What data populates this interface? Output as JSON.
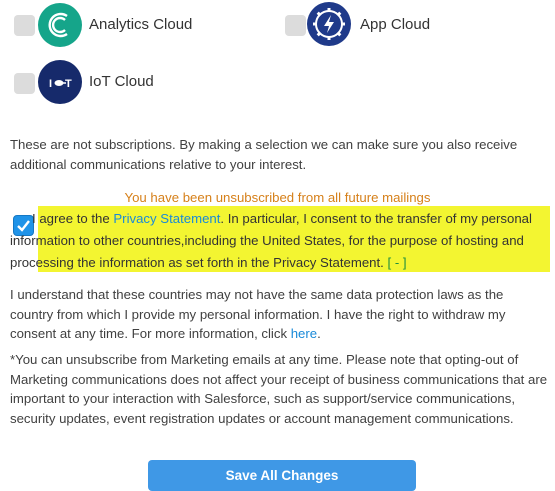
{
  "clouds": [
    {
      "label": "Analytics Cloud",
      "checked": false,
      "icon": "analytics-cloud-icon",
      "icon_color": "#15a58a"
    },
    {
      "label": "App Cloud",
      "checked": false,
      "icon": "app-cloud-gear-icon",
      "icon_color": "#1f3a8a"
    },
    {
      "label": "IoT Cloud",
      "checked": false,
      "icon": "iot-cloud-icon",
      "icon_color": "#162a6b"
    }
  ],
  "interest_note": "These are not subscriptions. By making a selection we can make sure you also receive additional communications relative to your interest.",
  "unsubscribed_message": "You have been unsubscribed from all future mailings",
  "consent": {
    "checked": true,
    "part1": "I agree to the ",
    "privacy_link": "Privacy Statement",
    "part2": ". In particular, I consent to the transfer of my personal information to other countries,including the United States, for the purpose of hosting and processing the information as set forth in the Privacy Statement. ",
    "collapse_toggle": "[ - ]"
  },
  "data_protection": {
    "text": "I understand that these countries may not have the same data protection laws as the country from which I provide my personal information. I have the right to withdraw my consent at any time. For more information, click ",
    "link": "here",
    "end": "."
  },
  "marketing_note": "*You can unsubscribe from Marketing emails at any time. Please note that opting-out of Marketing communications does not affect your receipt of business communications that are important to your interaction with Salesforce, such as support/service communications, security updates, event registration updates or account management communications.",
  "save_button": "Save All Changes",
  "colors": {
    "accent": "#1f93e8",
    "highlight": "#f3f531",
    "warning": "#d6801a"
  }
}
